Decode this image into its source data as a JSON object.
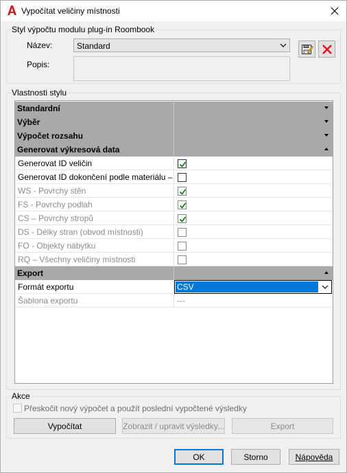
{
  "window": {
    "title": "Vypočítat veličiny místnosti",
    "app_icon": "autocad-a-icon",
    "close_icon": "close-icon"
  },
  "style_group": {
    "title": "Styl výpočtu modulu plug-in Roombook",
    "name_label": "Název:",
    "name_value": "Standard",
    "desc_label": "Popis:",
    "desc_value": "",
    "save_icon": "save-edit-icon",
    "delete_icon": "delete-x-icon",
    "delete_color": "#e81123"
  },
  "props_group": {
    "title": "Vlastnosti stylu",
    "categories": [
      {
        "name": "Standardní",
        "expanded": false
      },
      {
        "name": "Výběr",
        "expanded": false
      },
      {
        "name": "Výpočet rozsahu",
        "expanded": false
      },
      {
        "name": "Generovat výkresová data",
        "expanded": true
      },
      {
        "name": "Export",
        "expanded": true
      }
    ],
    "drawing_data_rows": [
      {
        "label": "Generovat ID veličin",
        "checked": true,
        "enabled": true
      },
      {
        "label": "Generovat ID dokončení podle materiálu – ...",
        "checked": false,
        "enabled": true
      },
      {
        "label": "WS - Povrchy stěn",
        "checked": true,
        "enabled": false
      },
      {
        "label": "FS - Povrchy podlah",
        "checked": true,
        "enabled": false
      },
      {
        "label": "CS – Povrchy stropů",
        "checked": true,
        "enabled": false
      },
      {
        "label": "DS - Délky stran (obvod místnosti)",
        "checked": false,
        "enabled": false
      },
      {
        "label": "FO - Objekty nábytku",
        "checked": false,
        "enabled": false
      },
      {
        "label": "RQ – Všechny veličiny místnosti",
        "checked": false,
        "enabled": false
      }
    ],
    "export_rows": [
      {
        "label": "Formát exportu",
        "value": "CSV",
        "enabled": true
      },
      {
        "label": "Šablona exportu",
        "value": "---",
        "enabled": false
      }
    ],
    "check_color": "#1a7a1a"
  },
  "actions_group": {
    "title": "Akce",
    "skip_label": "Přeskočit nový výpočet a použít poslední vypočtené výsledky",
    "skip_checked": false,
    "calc_button": "Vypočítat",
    "view_button": "Zobrazit / upravit výsledky...",
    "export_button": "Export"
  },
  "footer": {
    "ok": "OK",
    "cancel": "Storno",
    "help": "Nápověda"
  }
}
